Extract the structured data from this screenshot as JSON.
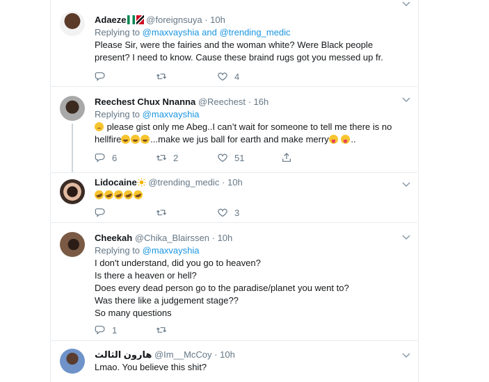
{
  "tweets": [
    {
      "name": "Adaeze",
      "handle": "@foreignsuya",
      "sep": "·",
      "time": "10h",
      "replying_prefix": "Replying to",
      "reply_mentions": [
        "@maxvayshia",
        "and",
        "@trending_medic"
      ],
      "lines": [
        "Please Sir, were the fairies and the woman white? Were Black people",
        "present? I need to know. Cause these braind rugs got you messed up fr."
      ],
      "reply_count": "",
      "retweet_count": "",
      "like_count": "4"
    },
    {
      "name": "Reechest Chux Nnanna",
      "handle": "@Reechest",
      "sep": "·",
      "time": "16h",
      "replying_prefix": "Replying to",
      "reply_mentions": [
        "@maxvayshia"
      ],
      "line1": "please gist only me Abeg..I can’t wait for someone to tell me there is no",
      "line2_a": "hellfire",
      "line2_b": "...make we jus ball for earth and make merry",
      "line2_c": "..",
      "reply_count": "6",
      "retweet_count": "2",
      "like_count": "51"
    },
    {
      "name": "Lidocaine",
      "handle": "@trending_medic",
      "sep": "·",
      "time": "10h",
      "reply_count": "",
      "retweet_count": "",
      "like_count": "3"
    },
    {
      "name": "Cheekah",
      "handle": "@Chika_Blairssen",
      "sep": "·",
      "time": "10h",
      "replying_prefix": "Replying to",
      "reply_mentions": [
        "@maxvayshia"
      ],
      "lines": [
        "I don't understand, did you go to heaven?",
        "Is there a heaven or hell?",
        "Does every dead person go to the paradise/planet you went to?",
        "Was there like a judgement stage??",
        "So many questions"
      ],
      "reply_count": "1",
      "retweet_count": "",
      "like_count": ""
    },
    {
      "name": "هارون الثالث",
      "handle": "@Im__McCoy",
      "sep": "·",
      "time": "10h",
      "lines": [
        "Lmao. You believe this shit?"
      ]
    }
  ],
  "colors": {
    "accent": "#1b95e0",
    "muted": "#657786",
    "text": "#14171a",
    "border": "#e6ecf0"
  }
}
